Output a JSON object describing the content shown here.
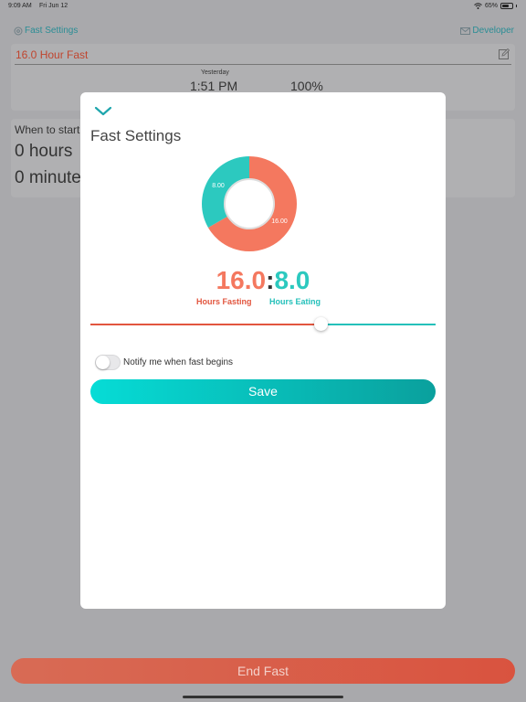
{
  "status_bar": {
    "time": "9:09 AM",
    "date": "Fri Jun 12",
    "battery": "65%"
  },
  "nav": {
    "left_label": "Fast Settings",
    "left_icon": "gear-icon",
    "right_label": "Developer",
    "right_icon": "mail-icon"
  },
  "current_fast": {
    "title": "16.0 Hour Fast",
    "day_label": "Yesterday",
    "start_time": "1:51 PM",
    "progress": "100%"
  },
  "when_to_start": {
    "label": "When to start",
    "hours": "0 hours",
    "minutes": "0 minutes"
  },
  "modal": {
    "title": "Fast Settings",
    "fasting_value": "16.0",
    "separator": ":",
    "eating_value": "8.0",
    "fasting_label": "Hours Fasting",
    "eating_label": "Hours Eating",
    "donut_fasting_label": "16.00",
    "donut_eating_label": "8.00",
    "fasting_hours": 16,
    "eating_hours": 8,
    "slider_fraction": 0.667,
    "notify_label": "Notify me when fast begins",
    "notify_on": false,
    "save_label": "Save"
  },
  "colors": {
    "fasting": "#f4785f",
    "eating": "#2cc9bf",
    "accent": "#2a8d95"
  },
  "end_fast_label": "End Fast"
}
